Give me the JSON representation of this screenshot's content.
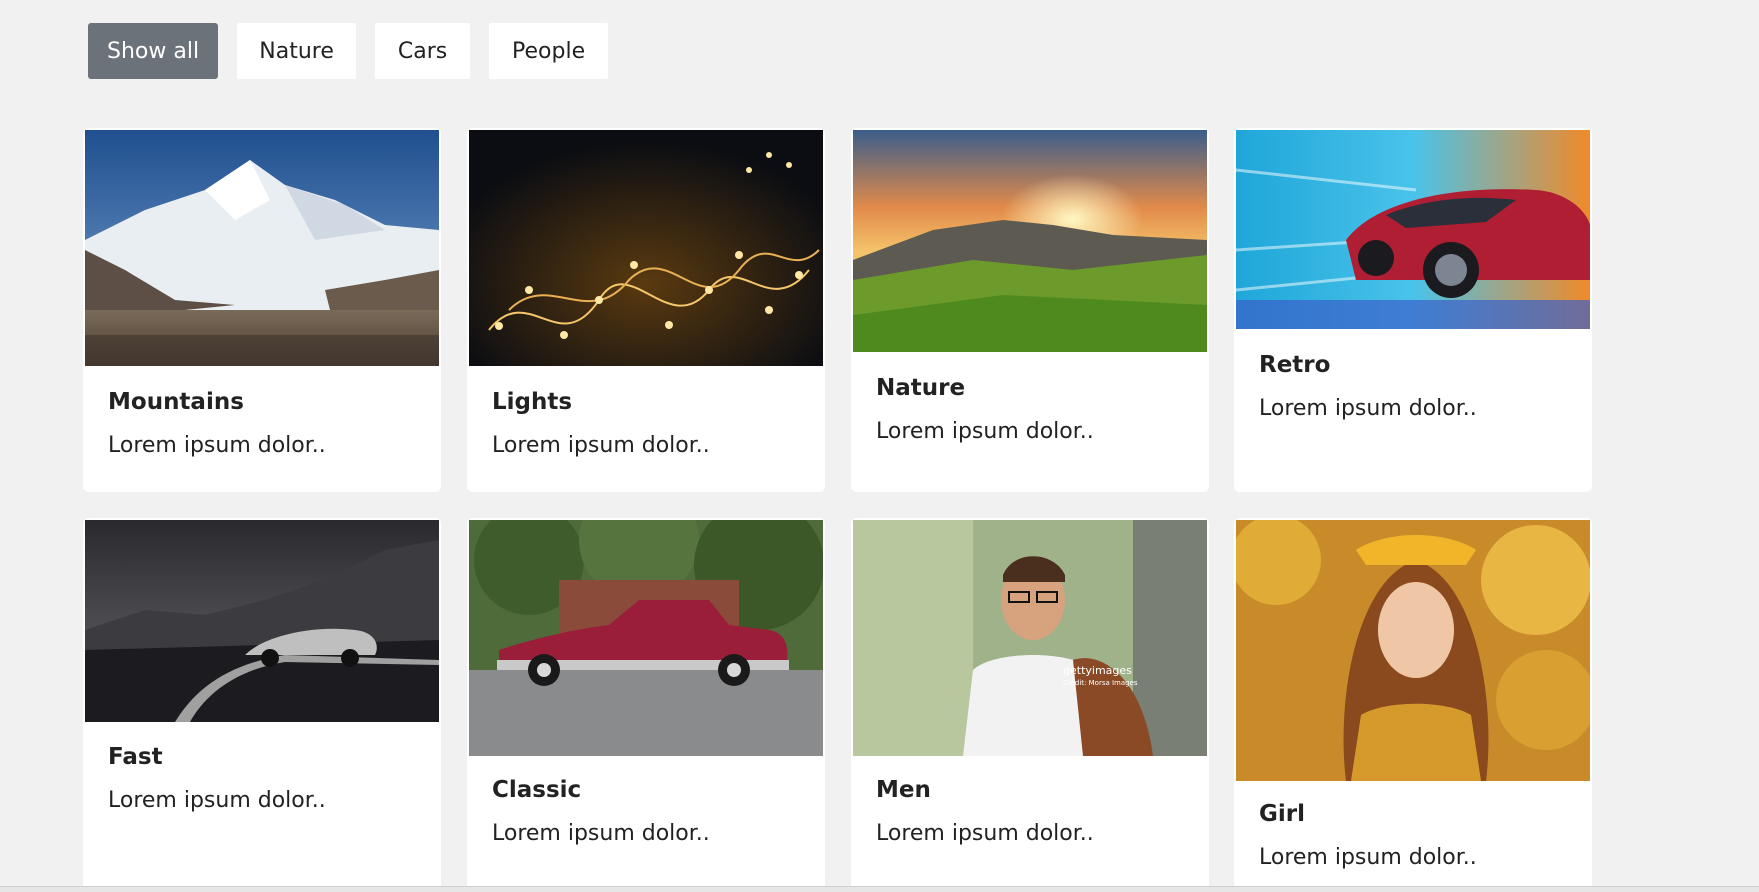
{
  "filters": [
    {
      "label": "Show all",
      "active": true
    },
    {
      "label": "Nature",
      "active": false
    },
    {
      "label": "Cars",
      "active": false
    },
    {
      "label": "People",
      "active": false
    }
  ],
  "cards": [
    {
      "title": "Mountains",
      "description": "Lorem ipsum dolor..",
      "image": "mountain-photo"
    },
    {
      "title": "Lights",
      "description": "Lorem ipsum dolor..",
      "image": "string-lights-photo"
    },
    {
      "title": "Nature",
      "description": "Lorem ipsum dolor..",
      "image": "sunset-meadow-photo"
    },
    {
      "title": "Retro",
      "description": "Lorem ipsum dolor..",
      "image": "speeding-car-photo"
    },
    {
      "title": "Fast",
      "description": "Lorem ipsum dolor..",
      "image": "sports-car-road-photo"
    },
    {
      "title": "Classic",
      "description": "Lorem ipsum dolor..",
      "image": "classic-red-car-photo"
    },
    {
      "title": "Men",
      "description": "Lorem ipsum dolor..",
      "image": "man-with-bag-photo"
    },
    {
      "title": "Girl",
      "description": "Lorem ipsum dolor..",
      "image": "girl-autumn-photo"
    }
  ],
  "overlay_text": {
    "getty": "gettyimages",
    "getty_credit": "Credit: Morsa Images"
  }
}
